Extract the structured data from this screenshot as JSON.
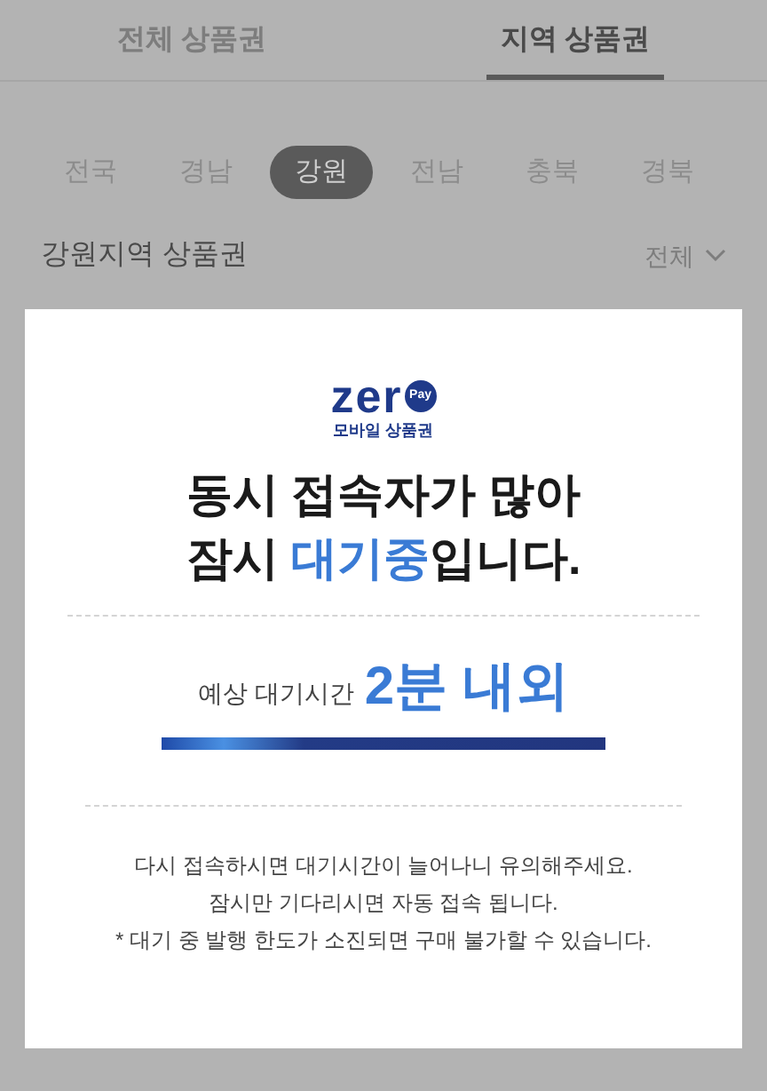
{
  "tabs": [
    {
      "label": "전체 상품권",
      "selected": false
    },
    {
      "label": "지역 상품권",
      "selected": true
    }
  ],
  "regions": [
    {
      "label": "전국",
      "selected": false
    },
    {
      "label": "경남",
      "selected": false
    },
    {
      "label": "강원",
      "selected": true
    },
    {
      "label": "전남",
      "selected": false
    },
    {
      "label": "충북",
      "selected": false
    },
    {
      "label": "경북",
      "selected": false
    }
  ],
  "section": {
    "title": "강원지역 상품권",
    "filter": "전체"
  },
  "modal": {
    "logo": {
      "word": "zer",
      "badge": "Pay",
      "subtitle": "모바일 상품권"
    },
    "title_lines": [
      [
        {
          "text": "동시 접속자가 많아",
          "highlight": false
        }
      ],
      [
        {
          "text": "잠시 ",
          "highlight": false
        },
        {
          "text": "대기중",
          "highlight": true
        },
        {
          "text": "입니다.",
          "highlight": false
        }
      ]
    ],
    "wait_label": "예상 대기시간",
    "wait_value": "2분 내외",
    "progress": {
      "level": 1
    },
    "notes": [
      "다시 접속하시면 대기시간이 늘어나니 유의해주세요.",
      "잠시만 기다리시면 자동 접속 됩니다.",
      "* 대기 중 발행 한도가 소진되면 구매 불가할 수 있습니다."
    ]
  }
}
